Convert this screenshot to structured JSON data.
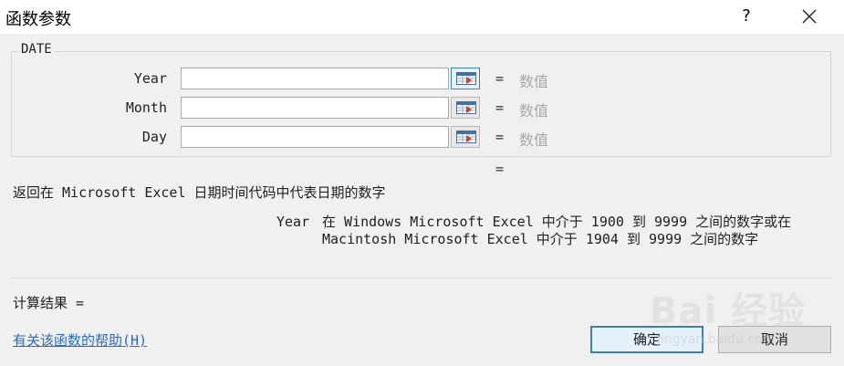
{
  "window": {
    "title": "函数参数",
    "help_label": "?"
  },
  "function": {
    "name": "DATE",
    "description": "返回在 Microsoft Excel 日期时间代码中代表日期的数字"
  },
  "arguments": [
    {
      "label": "Year",
      "value": "",
      "hint": "数值"
    },
    {
      "label": "Month",
      "value": "",
      "hint": "数值"
    },
    {
      "label": "Day",
      "value": "",
      "hint": "数值"
    }
  ],
  "equals": "=",
  "result_equals": "=",
  "argument_help": {
    "name": "Year",
    "text_line1": "在 Windows Microsoft Excel 中介于 1900 到 9999 之间的数字或在",
    "text_line2": "Macintosh Microsoft Excel 中介于 1904 到 9999 之间的数字"
  },
  "calc_result": "计算结果 =",
  "help_link": "有关该函数的帮助(H)",
  "buttons": {
    "ok": "确定",
    "cancel": "取消"
  },
  "watermark": {
    "logo_text": "Bai 经验",
    "url": "jingyan.baidu.com"
  }
}
